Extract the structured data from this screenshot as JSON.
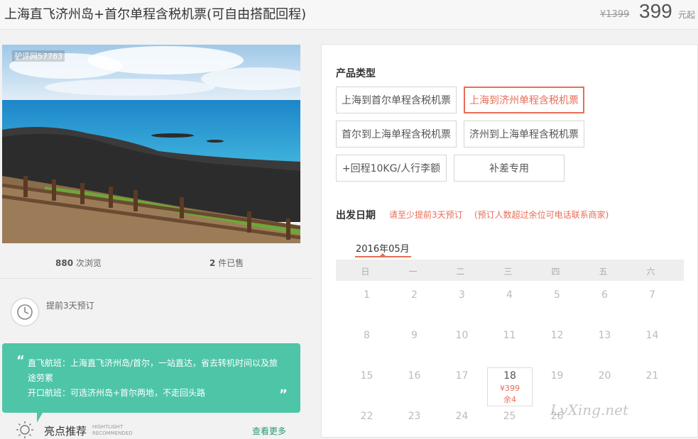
{
  "header": {
    "title": "上海直飞济州岛+首尔单程含税机票(可自由搭配回程)",
    "old_price": "¥1399",
    "price": "399",
    "price_unit": "元起"
  },
  "photo": {
    "id_label": "驴评网57783"
  },
  "stats": {
    "views_count": "880",
    "views_label": "次浏览",
    "sold_count": "2",
    "sold_label": "件已售"
  },
  "advance": {
    "text": "提前3天预订"
  },
  "highlight_box": {
    "line1": "直飞航班：上海直飞济州岛/首尔，一站直达，省去转机时间以及旅途劳累",
    "line2": "开口航班：可选济州岛+首尔两地，不走回头路"
  },
  "highlights": {
    "title": "亮点推荐",
    "en_line1": "HIGHTLIGHT",
    "en_line2": "RECOMMENDED",
    "more": "查看更多"
  },
  "product": {
    "label": "产品类型",
    "options": [
      {
        "label": "上海到首尔单程含税机票",
        "selected": false
      },
      {
        "label": "上海到济州单程含税机票",
        "selected": true
      },
      {
        "label": "首尔到上海单程含税机票",
        "selected": false
      },
      {
        "label": "济州到上海单程含税机票",
        "selected": false
      },
      {
        "label": "+回程10KG/人行李额",
        "selected": false
      },
      {
        "label": "补差专用",
        "selected": false
      }
    ]
  },
  "departure": {
    "label": "出发日期",
    "note1": "请至少提前3天预订",
    "note2": "(预订人数超过余位可电话联系商家)",
    "month": "2016年05月",
    "weekdays": [
      "日",
      "一",
      "二",
      "三",
      "四",
      "五",
      "六"
    ],
    "weeks": [
      [
        "1",
        "2",
        "3",
        "4",
        "5",
        "6",
        "7"
      ],
      [
        "8",
        "9",
        "10",
        "11",
        "12",
        "13",
        "14"
      ],
      [
        "15",
        "16",
        "17",
        "18",
        "19",
        "20",
        "21"
      ],
      [
        "22",
        "23",
        "24",
        "25",
        "26",
        "",
        ""
      ]
    ],
    "available": {
      "day": "18",
      "price": "¥399",
      "remaining": "余4"
    }
  },
  "watermark": "LvXing.net",
  "colors": {
    "accent": "#e96d58",
    "green": "#4fc5a7",
    "link": "#2b9a6e"
  }
}
